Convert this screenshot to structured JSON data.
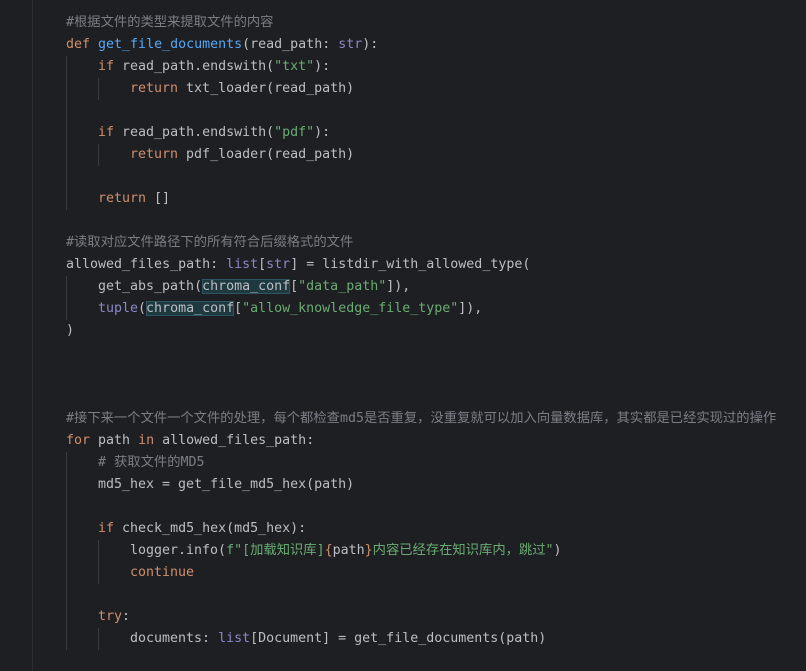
{
  "editor": {
    "colors": {
      "background": "#1e1f22",
      "default": "#bcbec4",
      "keyword": "#cf8e6d",
      "function": "#56a8f5",
      "string": "#6aab73",
      "builtin": "#8888c6",
      "comment": "#7a7e85",
      "highlight": "#1e3a40"
    },
    "lines": [
      {
        "indent": 0,
        "segments": [
          {
            "t": "comment",
            "v": "#根据文件的类型来提取文件的内容"
          }
        ]
      },
      {
        "indent": 0,
        "segments": [
          {
            "t": "keyword",
            "v": "def "
          },
          {
            "t": "function",
            "v": "get_file_documents"
          },
          {
            "t": "default",
            "v": "(read_path: "
          },
          {
            "t": "builtin",
            "v": "str"
          },
          {
            "t": "default",
            "v": "):"
          }
        ]
      },
      {
        "indent": 1,
        "segments": [
          {
            "t": "keyword",
            "v": "if "
          },
          {
            "t": "default",
            "v": "read_path.endswith("
          },
          {
            "t": "string",
            "v": "\"txt\""
          },
          {
            "t": "default",
            "v": "):"
          }
        ]
      },
      {
        "indent": 2,
        "segments": [
          {
            "t": "keyword",
            "v": "return "
          },
          {
            "t": "default",
            "v": "txt_loader(read_path)"
          }
        ]
      },
      {
        "indent": 0,
        "segments": []
      },
      {
        "indent": 1,
        "segments": [
          {
            "t": "keyword",
            "v": "if "
          },
          {
            "t": "default",
            "v": "read_path.endswith("
          },
          {
            "t": "string",
            "v": "\"pdf\""
          },
          {
            "t": "default",
            "v": "):"
          }
        ]
      },
      {
        "indent": 2,
        "segments": [
          {
            "t": "keyword",
            "v": "return "
          },
          {
            "t": "default",
            "v": "pdf_loader(read_path)"
          }
        ]
      },
      {
        "indent": 0,
        "segments": []
      },
      {
        "indent": 1,
        "segments": [
          {
            "t": "keyword",
            "v": "return "
          },
          {
            "t": "default",
            "v": "[]"
          }
        ]
      },
      {
        "indent": 0,
        "segments": []
      },
      {
        "indent": 0,
        "segments": [
          {
            "t": "comment",
            "v": "#读取对应文件路径下的所有符合后缀格式的文件"
          }
        ]
      },
      {
        "indent": 0,
        "segments": [
          {
            "t": "default",
            "v": "allowed_files_path: "
          },
          {
            "t": "builtin",
            "v": "list"
          },
          {
            "t": "default",
            "v": "["
          },
          {
            "t": "builtin",
            "v": "str"
          },
          {
            "t": "default",
            "v": "] = listdir_with_allowed_type("
          }
        ]
      },
      {
        "indent": 1,
        "segments": [
          {
            "t": "default",
            "v": "get_abs_path("
          },
          {
            "t": "hl",
            "v": "chroma_conf"
          },
          {
            "t": "default",
            "v": "["
          },
          {
            "t": "string",
            "v": "\"data_path\""
          },
          {
            "t": "default",
            "v": "]),"
          }
        ]
      },
      {
        "indent": 1,
        "segments": [
          {
            "t": "builtin",
            "v": "tuple"
          },
          {
            "t": "default",
            "v": "("
          },
          {
            "t": "hl",
            "v": "chroma_conf"
          },
          {
            "t": "default",
            "v": "["
          },
          {
            "t": "string",
            "v": "\"allow_knowledge_file_type\""
          },
          {
            "t": "default",
            "v": "]),"
          }
        ]
      },
      {
        "indent": 0,
        "segments": [
          {
            "t": "default",
            "v": ")"
          }
        ]
      },
      {
        "indent": 0,
        "segments": []
      },
      {
        "indent": 0,
        "segments": []
      },
      {
        "indent": 0,
        "segments": []
      },
      {
        "indent": 0,
        "segments": [
          {
            "t": "comment",
            "v": "#接下来一个文件一个文件的处理，每个都检查md5是否重复，没重复就可以加入向量数据库，其实都是已经实现过的操作"
          }
        ]
      },
      {
        "indent": 0,
        "segments": [
          {
            "t": "keyword",
            "v": "for "
          },
          {
            "t": "default",
            "v": "path "
          },
          {
            "t": "keyword",
            "v": "in "
          },
          {
            "t": "default",
            "v": "allowed_files_path:"
          }
        ]
      },
      {
        "indent": 1,
        "segments": [
          {
            "t": "comment",
            "v": "# 获取文件的MD5"
          }
        ]
      },
      {
        "indent": 1,
        "segments": [
          {
            "t": "default",
            "v": "md5_hex = get_file_md5_hex(path)"
          }
        ]
      },
      {
        "indent": 0,
        "segments": []
      },
      {
        "indent": 1,
        "segments": [
          {
            "t": "keyword",
            "v": "if "
          },
          {
            "t": "default",
            "v": "check_md5_hex(md5_hex):"
          }
        ]
      },
      {
        "indent": 2,
        "segments": [
          {
            "t": "default",
            "v": "logger.info("
          },
          {
            "t": "string",
            "v": "f\"[加载知识库]"
          },
          {
            "t": "interp",
            "v": "{"
          },
          {
            "t": "default",
            "v": "path"
          },
          {
            "t": "interp",
            "v": "}"
          },
          {
            "t": "string",
            "v": "内容已经存在知识库内，跳过\""
          },
          {
            "t": "default",
            "v": ")"
          }
        ]
      },
      {
        "indent": 2,
        "segments": [
          {
            "t": "keyword",
            "v": "continue"
          }
        ]
      },
      {
        "indent": 0,
        "segments": []
      },
      {
        "indent": 1,
        "segments": [
          {
            "t": "keyword",
            "v": "try"
          },
          {
            "t": "default",
            "v": ":"
          }
        ]
      },
      {
        "indent": 2,
        "segments": [
          {
            "t": "default",
            "v": "documents: "
          },
          {
            "t": "builtin",
            "v": "list"
          },
          {
            "t": "default",
            "v": "[Document] = get_file_documents(path)"
          }
        ]
      },
      {
        "indent": 0,
        "segments": []
      }
    ]
  }
}
